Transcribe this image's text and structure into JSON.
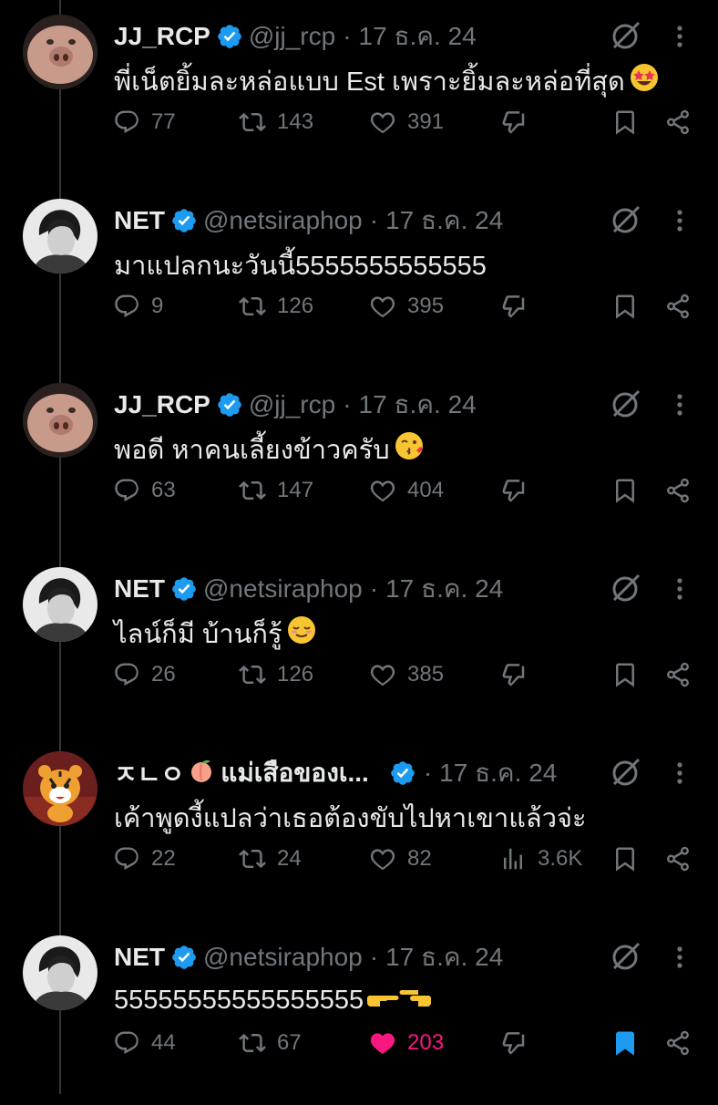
{
  "tweets": [
    {
      "name": "JJ_RCP",
      "handle": "@jj_rcp",
      "dot": "·",
      "date": "17 ธ.ค. 24",
      "text": "พี่เน็ตยิ้มละหล่อแบบ Est เพราะยิ้มละหล่อที่สุด",
      "emoji": "star-struck-emoji",
      "avatar": "jj-avatar",
      "replies": "77",
      "retweets": "143",
      "likes": "391",
      "liked": false,
      "bookmarked": false,
      "fourth": "downvote"
    },
    {
      "name": "NET",
      "handle": "@netsiraphop",
      "dot": "·",
      "date": "17 ธ.ค. 24",
      "text": "มาแปลกนะวันนี้5555555555555",
      "emoji": "",
      "avatar": "net-avatar",
      "replies": "9",
      "retweets": "126",
      "likes": "395",
      "liked": false,
      "bookmarked": false,
      "fourth": "downvote"
    },
    {
      "name": "JJ_RCP",
      "handle": "@jj_rcp",
      "dot": "·",
      "date": "17 ธ.ค. 24",
      "text": "พอดี หาคนเลี้ยงข้าวครับ",
      "emoji": "kissing-emoji",
      "avatar": "jj-avatar",
      "replies": "63",
      "retweets": "147",
      "likes": "404",
      "liked": false,
      "bookmarked": false,
      "fourth": "downvote"
    },
    {
      "name": "NET",
      "handle": "@netsiraphop",
      "dot": "·",
      "date": "17 ธ.ค. 24",
      "text": "ไลน์ก็มี บ้านก็รู้",
      "emoji": "relieved-emoji",
      "avatar": "net-avatar",
      "replies": "26",
      "retweets": "126",
      "likes": "385",
      "liked": false,
      "bookmarked": false,
      "fourth": "downvote"
    },
    {
      "name": "ㅈㄴㅇ",
      "name_extra": "แม่เสือของเ...",
      "handle": "",
      "dot": "·",
      "date": "17 ธ.ค. 24",
      "text": "เค้าพูดงี้แปลว่าเธอต้องขับไปหาเขาแล้วจ่ะ",
      "emoji": "",
      "avatar": "tiger-avatar",
      "replies": "22",
      "retweets": "24",
      "likes": "82",
      "views": "3.6K",
      "liked": false,
      "bookmarked": false,
      "fourth": "views"
    },
    {
      "name": "NET",
      "handle": "@netsiraphop",
      "dot": "·",
      "date": "17 ธ.ค. 24",
      "text": "55555555555555555",
      "emoji": "pointing-hands-emoji",
      "avatar": "net-avatar",
      "replies": "44",
      "retweets": "67",
      "likes": "203",
      "liked": true,
      "bookmarked": true,
      "fourth": "downvote"
    }
  ],
  "colors": {
    "background": "#000000",
    "muted": "#71767b",
    "text": "#e7e9ea",
    "verified": "#1d9bf0",
    "like": "#f91880",
    "thread_line": "#333639"
  }
}
